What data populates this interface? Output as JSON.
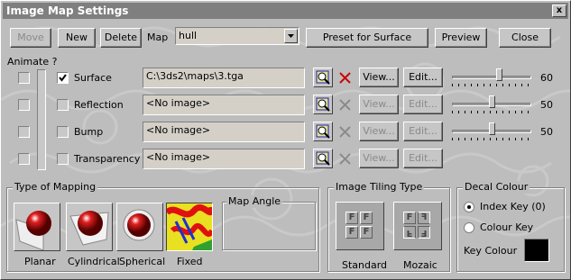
{
  "window": {
    "title": "Image Map Settings",
    "close_glyph": "x"
  },
  "toolbar": {
    "move_label": "Move",
    "new_label": "New",
    "delete_label": "Delete",
    "map_label": "Map",
    "map_value": "hull",
    "preset_label": "Preset for Surface",
    "preview_label": "Preview",
    "close_label": "Close"
  },
  "animate_label": "Animate ?",
  "rows": [
    {
      "label": "Surface",
      "checked": true,
      "path": "C:\\3ds2\\maps\\3.tga",
      "view_label": "View...",
      "edit_label": "Edit...",
      "value": "60",
      "level": 0.6,
      "enabled": true
    },
    {
      "label": "Reflection",
      "checked": false,
      "path": "<No image>",
      "view_label": "View...",
      "edit_label": "Edit...",
      "value": "50",
      "level": 0.5,
      "enabled": false
    },
    {
      "label": "Bump",
      "checked": false,
      "path": "<No image>",
      "view_label": "View...",
      "edit_label": "Edit...",
      "value": "50",
      "level": 0.5,
      "enabled": false
    },
    {
      "label": "Transparency",
      "checked": false,
      "path": "<No image>",
      "view_label": "View...",
      "edit_label": "Edit...",
      "value": "",
      "level": null,
      "enabled": false
    }
  ],
  "mapping": {
    "group_title": "Type of Mapping",
    "angle_title": "Map Angle",
    "options": [
      {
        "label": "Planar"
      },
      {
        "label": "Cylindrical"
      },
      {
        "label": "Spherical"
      },
      {
        "label": "Fixed"
      }
    ]
  },
  "tiling": {
    "group_title": "Image Tiling Type",
    "standard_label": "Standard",
    "mozaic_label": "Mozaic",
    "tile_glyph": "F"
  },
  "decal": {
    "group_title": "Decal Colour",
    "index_key_label": "Index Key (0)",
    "colour_key_label": "Colour Key",
    "key_colour_label": "Key Colour",
    "key_colour": "#000000",
    "selected": "index_key"
  },
  "colors": {
    "window_bg": "#bdbdbd",
    "title_bg": "#7f7f7f",
    "delete_x": "#cc0000",
    "sphere": "#cc1010"
  },
  "icons": [
    "browse-icon",
    "delete-x-icon",
    "planar-map-icon",
    "cylindrical-map-icon",
    "spherical-map-icon",
    "fixed-map-icon",
    "standard-tiling-icon",
    "mozaic-tiling-icon"
  ]
}
